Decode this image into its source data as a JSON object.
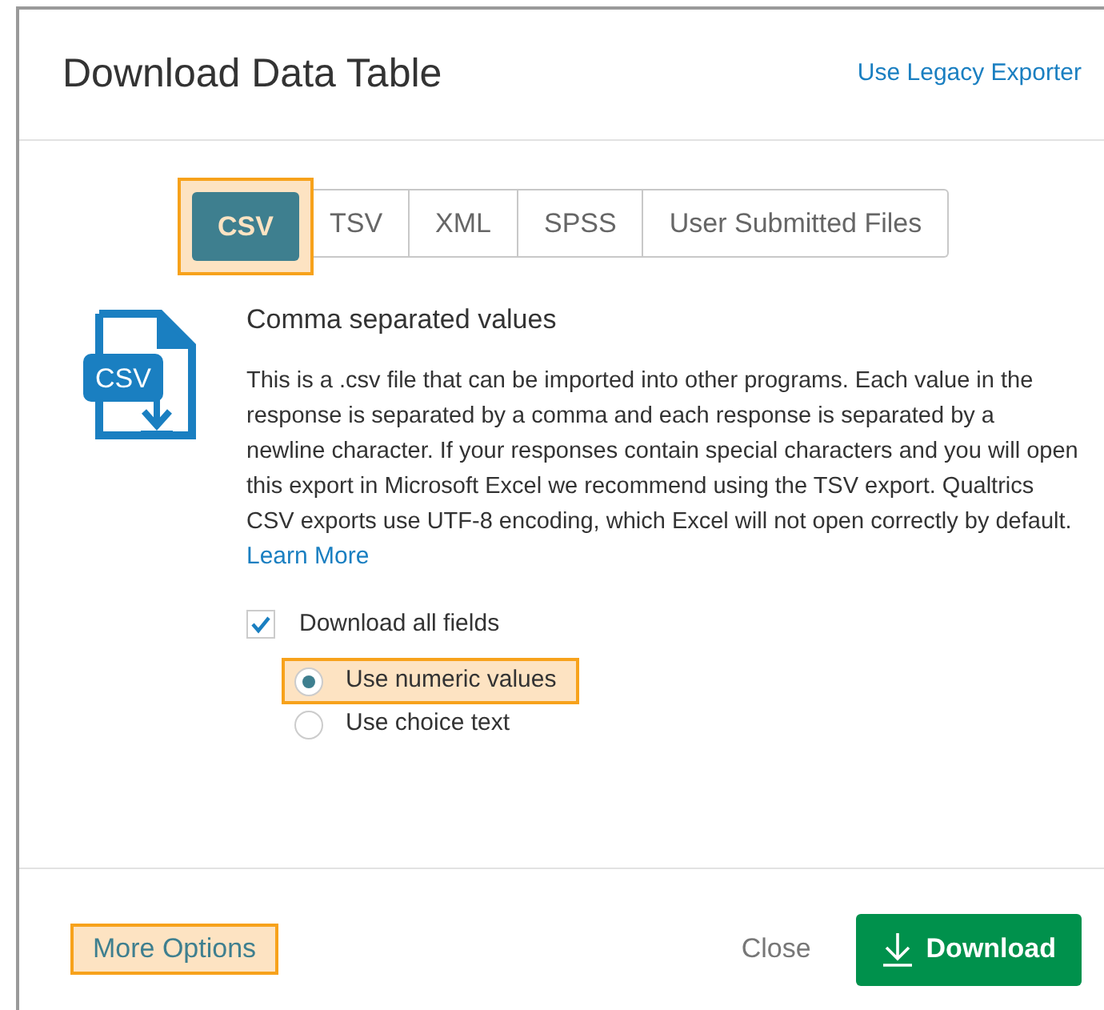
{
  "dialog": {
    "title": "Download Data Table",
    "legacy_link": "Use Legacy Exporter"
  },
  "tabs": [
    {
      "label": "CSV",
      "selected": true,
      "highlighted": true
    },
    {
      "label": "TSV",
      "selected": false,
      "highlighted": false
    },
    {
      "label": "XML",
      "selected": false,
      "highlighted": false
    },
    {
      "label": "SPSS",
      "selected": false,
      "highlighted": false
    },
    {
      "label": "User Submitted Files",
      "selected": false,
      "highlighted": false
    }
  ],
  "format": {
    "icon_label": "CSV",
    "heading": "Comma separated values",
    "description": "This is a .csv file that can be imported into other programs. Each value in the response is separated by a comma and each response is separated by a newline character. If your responses contain special characters and you will open this export in Microsoft Excel we recommend using the TSV export. Qualtrics CSV exports use UTF-8 encoding, which Excel will not open correctly by default.",
    "learn_more": "Learn More"
  },
  "download_all_fields": {
    "label": "Download all fields",
    "checked": true
  },
  "value_options": [
    {
      "label": "Use numeric values",
      "selected": true,
      "highlighted": true
    },
    {
      "label": "Use choice text",
      "selected": false,
      "highlighted": false
    }
  ],
  "footer": {
    "more_options": {
      "label": "More Options",
      "highlighted": true
    },
    "close": "Close",
    "download": "Download"
  }
}
